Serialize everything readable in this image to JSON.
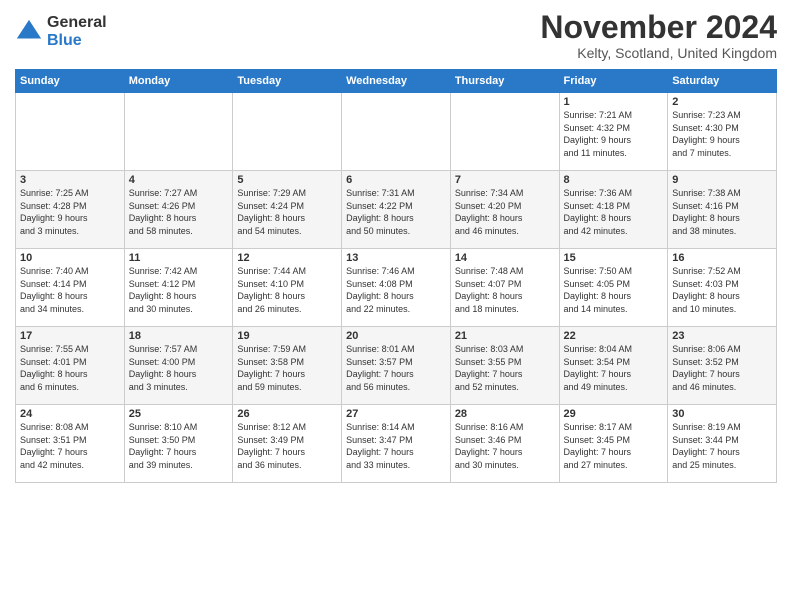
{
  "logo": {
    "general": "General",
    "blue": "Blue"
  },
  "title": "November 2024",
  "location": "Kelty, Scotland, United Kingdom",
  "days_of_week": [
    "Sunday",
    "Monday",
    "Tuesday",
    "Wednesday",
    "Thursday",
    "Friday",
    "Saturday"
  ],
  "rows": [
    [
      {
        "day": "",
        "info": ""
      },
      {
        "day": "",
        "info": ""
      },
      {
        "day": "",
        "info": ""
      },
      {
        "day": "",
        "info": ""
      },
      {
        "day": "",
        "info": ""
      },
      {
        "day": "1",
        "info": "Sunrise: 7:21 AM\nSunset: 4:32 PM\nDaylight: 9 hours\nand 11 minutes."
      },
      {
        "day": "2",
        "info": "Sunrise: 7:23 AM\nSunset: 4:30 PM\nDaylight: 9 hours\nand 7 minutes."
      }
    ],
    [
      {
        "day": "3",
        "info": "Sunrise: 7:25 AM\nSunset: 4:28 PM\nDaylight: 9 hours\nand 3 minutes."
      },
      {
        "day": "4",
        "info": "Sunrise: 7:27 AM\nSunset: 4:26 PM\nDaylight: 8 hours\nand 58 minutes."
      },
      {
        "day": "5",
        "info": "Sunrise: 7:29 AM\nSunset: 4:24 PM\nDaylight: 8 hours\nand 54 minutes."
      },
      {
        "day": "6",
        "info": "Sunrise: 7:31 AM\nSunset: 4:22 PM\nDaylight: 8 hours\nand 50 minutes."
      },
      {
        "day": "7",
        "info": "Sunrise: 7:34 AM\nSunset: 4:20 PM\nDaylight: 8 hours\nand 46 minutes."
      },
      {
        "day": "8",
        "info": "Sunrise: 7:36 AM\nSunset: 4:18 PM\nDaylight: 8 hours\nand 42 minutes."
      },
      {
        "day": "9",
        "info": "Sunrise: 7:38 AM\nSunset: 4:16 PM\nDaylight: 8 hours\nand 38 minutes."
      }
    ],
    [
      {
        "day": "10",
        "info": "Sunrise: 7:40 AM\nSunset: 4:14 PM\nDaylight: 8 hours\nand 34 minutes."
      },
      {
        "day": "11",
        "info": "Sunrise: 7:42 AM\nSunset: 4:12 PM\nDaylight: 8 hours\nand 30 minutes."
      },
      {
        "day": "12",
        "info": "Sunrise: 7:44 AM\nSunset: 4:10 PM\nDaylight: 8 hours\nand 26 minutes."
      },
      {
        "day": "13",
        "info": "Sunrise: 7:46 AM\nSunset: 4:08 PM\nDaylight: 8 hours\nand 22 minutes."
      },
      {
        "day": "14",
        "info": "Sunrise: 7:48 AM\nSunset: 4:07 PM\nDaylight: 8 hours\nand 18 minutes."
      },
      {
        "day": "15",
        "info": "Sunrise: 7:50 AM\nSunset: 4:05 PM\nDaylight: 8 hours\nand 14 minutes."
      },
      {
        "day": "16",
        "info": "Sunrise: 7:52 AM\nSunset: 4:03 PM\nDaylight: 8 hours\nand 10 minutes."
      }
    ],
    [
      {
        "day": "17",
        "info": "Sunrise: 7:55 AM\nSunset: 4:01 PM\nDaylight: 8 hours\nand 6 minutes."
      },
      {
        "day": "18",
        "info": "Sunrise: 7:57 AM\nSunset: 4:00 PM\nDaylight: 8 hours\nand 3 minutes."
      },
      {
        "day": "19",
        "info": "Sunrise: 7:59 AM\nSunset: 3:58 PM\nDaylight: 7 hours\nand 59 minutes."
      },
      {
        "day": "20",
        "info": "Sunrise: 8:01 AM\nSunset: 3:57 PM\nDaylight: 7 hours\nand 56 minutes."
      },
      {
        "day": "21",
        "info": "Sunrise: 8:03 AM\nSunset: 3:55 PM\nDaylight: 7 hours\nand 52 minutes."
      },
      {
        "day": "22",
        "info": "Sunrise: 8:04 AM\nSunset: 3:54 PM\nDaylight: 7 hours\nand 49 minutes."
      },
      {
        "day": "23",
        "info": "Sunrise: 8:06 AM\nSunset: 3:52 PM\nDaylight: 7 hours\nand 46 minutes."
      }
    ],
    [
      {
        "day": "24",
        "info": "Sunrise: 8:08 AM\nSunset: 3:51 PM\nDaylight: 7 hours\nand 42 minutes."
      },
      {
        "day": "25",
        "info": "Sunrise: 8:10 AM\nSunset: 3:50 PM\nDaylight: 7 hours\nand 39 minutes."
      },
      {
        "day": "26",
        "info": "Sunrise: 8:12 AM\nSunset: 3:49 PM\nDaylight: 7 hours\nand 36 minutes."
      },
      {
        "day": "27",
        "info": "Sunrise: 8:14 AM\nSunset: 3:47 PM\nDaylight: 7 hours\nand 33 minutes."
      },
      {
        "day": "28",
        "info": "Sunrise: 8:16 AM\nSunset: 3:46 PM\nDaylight: 7 hours\nand 30 minutes."
      },
      {
        "day": "29",
        "info": "Sunrise: 8:17 AM\nSunset: 3:45 PM\nDaylight: 7 hours\nand 27 minutes."
      },
      {
        "day": "30",
        "info": "Sunrise: 8:19 AM\nSunset: 3:44 PM\nDaylight: 7 hours\nand 25 minutes."
      }
    ]
  ]
}
